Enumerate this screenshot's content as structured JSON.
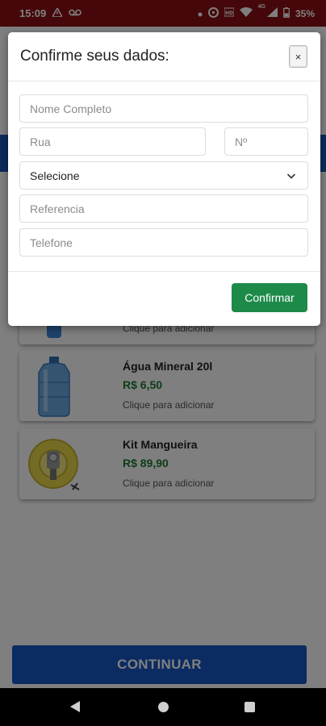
{
  "status_bar": {
    "time": "15:09",
    "network_label": "4G",
    "battery": "35%"
  },
  "products": [
    {
      "name": "",
      "price": "",
      "hint": "Clique para adicionar"
    },
    {
      "name": "Água Mineral 20l",
      "price": "R$ 6,50",
      "hint": "Clique para adicionar"
    },
    {
      "name": "Kit Mangueira",
      "price": "R$ 89,90",
      "hint": "Clique para adicionar"
    }
  ],
  "continue_button": {
    "label": "CONTINUAR"
  },
  "modal": {
    "title": "Confirme seus dados:",
    "close_label": "×",
    "fields": {
      "full_name": {
        "placeholder": "Nome Completo"
      },
      "street": {
        "placeholder": "Rua"
      },
      "number": {
        "placeholder": "Nº"
      },
      "select": {
        "value": "Selecione"
      },
      "reference": {
        "placeholder": "Referencia"
      },
      "phone": {
        "placeholder": "Telefone"
      }
    },
    "confirm_label": "Confirmar"
  },
  "colors": {
    "status_bar": "#8a0f12",
    "primary_blue": "#1756c4",
    "confirm_green": "#1e8a4a",
    "price_green": "#1c7a2e"
  },
  "icons": {
    "status_left": [
      "warning-icon",
      "voicemail-icon"
    ],
    "status_right": [
      "dot-icon",
      "sync-icon",
      "hd-icon",
      "wifi-icon",
      "signal-icon",
      "battery-icon"
    ],
    "select": "chevron-down-icon",
    "nav": [
      "back-icon",
      "home-icon",
      "recents-icon"
    ]
  }
}
